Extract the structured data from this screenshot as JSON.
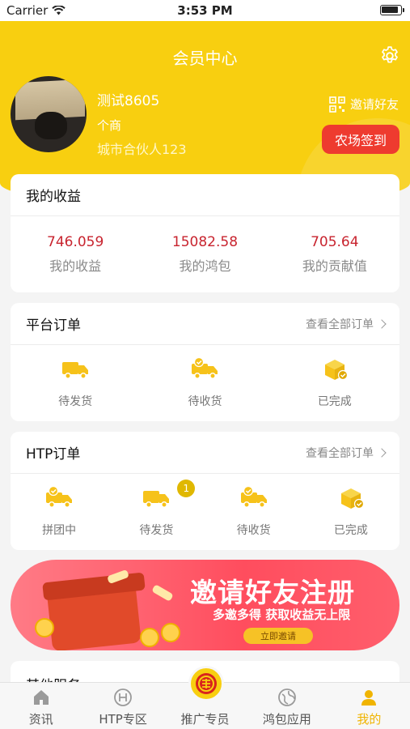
{
  "status": {
    "carrier": "Carrier",
    "time": "3:53 PM"
  },
  "header": {
    "title": "会员中心",
    "settings_icon": "gear-icon"
  },
  "user": {
    "name": "测试8605",
    "type": "个商",
    "partner": "城市合伙人123",
    "invite_label": "邀请好友",
    "farm_sign_label": "农场签到"
  },
  "earnings": {
    "title": "我的收益",
    "items": [
      {
        "value": "746.059",
        "label": "我的收益"
      },
      {
        "value": "15082.58",
        "label": "我的鸿包"
      },
      {
        "value": "705.64",
        "label": "我的贡献值"
      }
    ]
  },
  "platform_orders": {
    "title": "平台订单",
    "link": "查看全部订单",
    "items": [
      {
        "label": "待发货",
        "icon": "truck-icon"
      },
      {
        "label": "待收货",
        "icon": "truck-check-icon"
      },
      {
        "label": "已完成",
        "icon": "box-check-icon"
      }
    ]
  },
  "htp_orders": {
    "title": "HTP订单",
    "link": "查看全部订单",
    "items": [
      {
        "label": "拼团中",
        "icon": "truck-check-icon",
        "badge": ""
      },
      {
        "label": "待发货",
        "icon": "truck-icon",
        "badge": "1"
      },
      {
        "label": "待收货",
        "icon": "truck-check-icon",
        "badge": ""
      },
      {
        "label": "已完成",
        "icon": "box-check-icon",
        "badge": ""
      }
    ]
  },
  "banner": {
    "title": "邀请好友注册",
    "subtitle": "多邀多得 获取收益无上限",
    "button": "立即邀请"
  },
  "other_services": {
    "title": "其他服务"
  },
  "tabbar": [
    {
      "label": "资讯",
      "icon": "home-icon"
    },
    {
      "label": "HTP专区",
      "icon": "htp-icon"
    },
    {
      "label": "推广专员",
      "icon": "promo-icon"
    },
    {
      "label": "鸿包应用",
      "icon": "globe-icon"
    },
    {
      "label": "我的",
      "icon": "person-icon",
      "active": true
    }
  ],
  "colors": {
    "brand": "#f8cf10",
    "accent_red": "#ee3b2f",
    "value_red": "#c8242f",
    "tab_active": "#f0b400"
  }
}
